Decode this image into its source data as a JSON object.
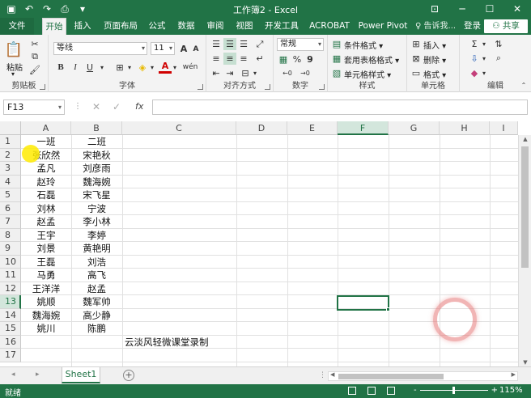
{
  "window": {
    "title": "工作簿2 - Excel",
    "min": "─",
    "max": "☐",
    "close": "✕"
  },
  "tabs": {
    "file": "文件",
    "items": [
      "开始",
      "插入",
      "页面布局",
      "公式",
      "数据",
      "审阅",
      "视图",
      "开发工具",
      "ACROBAT",
      "Power Pivot"
    ],
    "active": "开始",
    "tell_me": "告诉我...",
    "sign_in": "登录",
    "share": "共享"
  },
  "ribbon": {
    "clipboard": {
      "label": "剪贴板",
      "paste": "粘贴"
    },
    "font": {
      "label": "字体",
      "name": "等线",
      "size": "11",
      "bold": "B",
      "italic": "I",
      "underline": "U",
      "grow": "A",
      "shrink": "A"
    },
    "alignment": {
      "label": "对齐方式"
    },
    "number": {
      "label": "数字",
      "format": "常规",
      "percent": "%",
      "comma": "9"
    },
    "styles": {
      "label": "样式",
      "conditional": "条件格式",
      "table": "套用表格格式",
      "cell": "单元格样式"
    },
    "cells": {
      "label": "单元格",
      "insert": "插入",
      "delete": "删除",
      "format": "格式"
    },
    "editing": {
      "label": "编辑"
    }
  },
  "formula_bar": {
    "name_box": "F13",
    "fx": "fx",
    "content": ""
  },
  "sheet": {
    "columns": [
      "A",
      "B",
      "C",
      "D",
      "E",
      "F",
      "G",
      "H",
      "I"
    ],
    "rows": [
      "1",
      "2",
      "3",
      "4",
      "5",
      "6",
      "7",
      "8",
      "9",
      "10",
      "11",
      "12",
      "13",
      "14",
      "15",
      "16",
      "17"
    ],
    "selected_cell": "F13",
    "colA": [
      "一班",
      "张欣然",
      "孟凡",
      "赵玲",
      "石磊",
      "刘林",
      "赵孟",
      "王宇",
      "刘景",
      "王磊",
      "马勇",
      "王洋洋",
      "姚顺",
      "魏海婉",
      "姚川",
      "",
      ""
    ],
    "colB": [
      "二班",
      "宋艳秋",
      "刘彦雨",
      "魏海婉",
      "宋飞星",
      "宁波",
      "李小林",
      "李婷",
      "黄艳明",
      "刘浩",
      "高飞",
      "赵孟",
      "魏军帅",
      "高少静",
      "陈鹏",
      "",
      ""
    ],
    "c16": "云淡风轻微课堂录制"
  },
  "sheet_tabs": {
    "prev": "◂",
    "next": "▸",
    "items": [
      "Sheet1"
    ],
    "add": "+"
  },
  "status": {
    "ready": "就绪",
    "zoom_minus": "-",
    "zoom_plus": "+",
    "zoom": "115%"
  }
}
